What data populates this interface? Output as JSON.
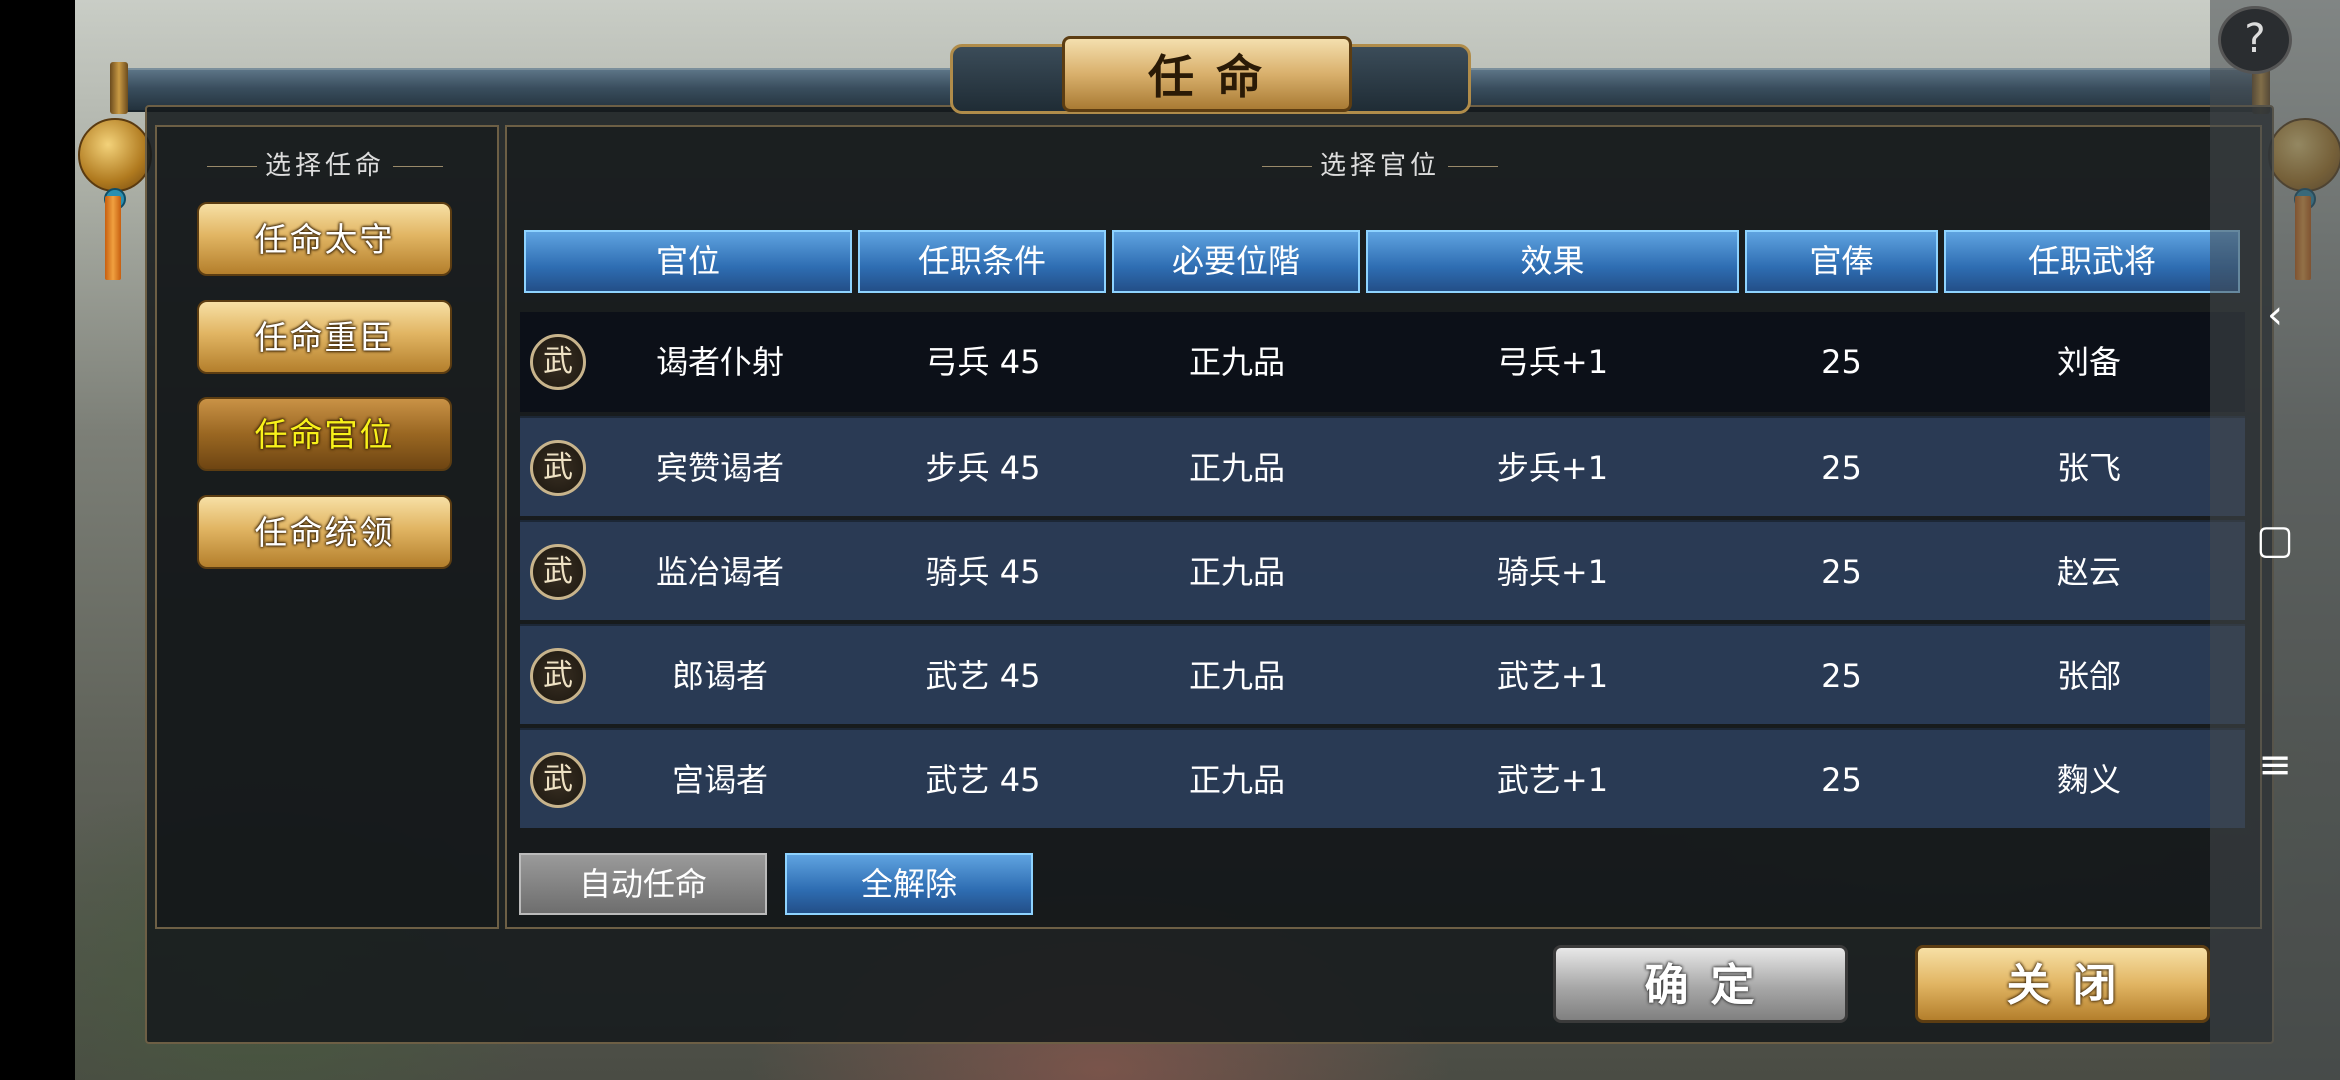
{
  "window": {
    "title": "任命"
  },
  "left_panel": {
    "section_title": "选择任命",
    "menu": [
      {
        "label": "任命太守",
        "active": false
      },
      {
        "label": "任命重臣",
        "active": false
      },
      {
        "label": "任命官位",
        "active": true
      },
      {
        "label": "任命统领",
        "active": false
      }
    ]
  },
  "right_panel": {
    "section_title": "选择官位",
    "columns": [
      "官位",
      "任职条件",
      "必要位階",
      "效果",
      "官俸",
      "任职武将"
    ],
    "rows": [
      {
        "badge": "武",
        "position": "谒者仆射",
        "requirement": "弓兵 45",
        "rank": "正九品",
        "effect": "弓兵+1",
        "salary": "25",
        "general": "刘备"
      },
      {
        "badge": "武",
        "position": "宾赞谒者",
        "requirement": "步兵 45",
        "rank": "正九品",
        "effect": "步兵+1",
        "salary": "25",
        "general": "张飞"
      },
      {
        "badge": "武",
        "position": "监冶谒者",
        "requirement": "骑兵 45",
        "rank": "正九品",
        "effect": "骑兵+1",
        "salary": "25",
        "general": "赵云"
      },
      {
        "badge": "武",
        "position": "郎谒者",
        "requirement": "武艺 45",
        "rank": "正九品",
        "effect": "武艺+1",
        "salary": "25",
        "general": "张郃"
      },
      {
        "badge": "武",
        "position": "宫谒者",
        "requirement": "武艺 45",
        "rank": "正九品",
        "effect": "武艺+1",
        "salary": "25",
        "general": "麴义"
      }
    ],
    "auto_button": "自动任命",
    "release_all_button": "全解除"
  },
  "footer": {
    "confirm": "确定",
    "close": "关闭"
  },
  "system": {
    "help": "?",
    "nav_back": "‹",
    "nav_home": "▢",
    "nav_menu": "≡"
  },
  "colors": {
    "gold": "#e1b563",
    "blue_header": "#2e6db2",
    "active_text": "#f8f11a"
  }
}
